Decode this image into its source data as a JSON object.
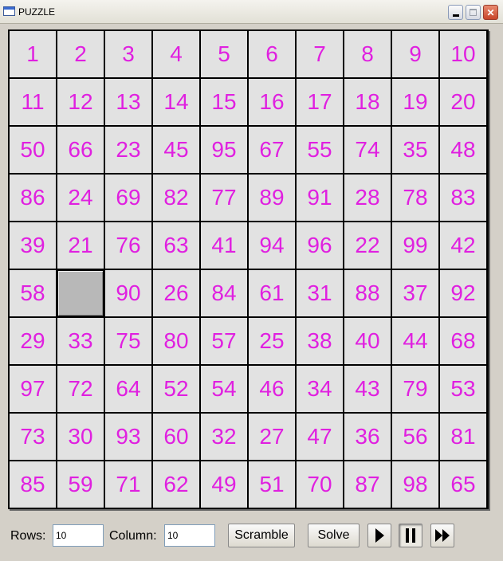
{
  "window": {
    "title": "PUZZLE",
    "minimize_icon": "minimize-icon",
    "maximize_icon": "maximize-icon",
    "close_label": "✕"
  },
  "board": {
    "rows": 10,
    "columns": 10,
    "tile_text_color": "#e020e0",
    "tile_bg_color": "#e2e2e2",
    "blank_bg_color": "#b8b8b8",
    "tiles": [
      [
        "1",
        "2",
        "3",
        "4",
        "5",
        "6",
        "7",
        "8",
        "9",
        "10"
      ],
      [
        "11",
        "12",
        "13",
        "14",
        "15",
        "16",
        "17",
        "18",
        "19",
        "20"
      ],
      [
        "50",
        "66",
        "23",
        "45",
        "95",
        "67",
        "55",
        "74",
        "35",
        "48"
      ],
      [
        "86",
        "24",
        "69",
        "82",
        "77",
        "89",
        "91",
        "28",
        "78",
        "83"
      ],
      [
        "39",
        "21",
        "76",
        "63",
        "41",
        "94",
        "96",
        "22",
        "99",
        "42"
      ],
      [
        "58",
        "",
        "90",
        "26",
        "84",
        "61",
        "31",
        "88",
        "37",
        "92"
      ],
      [
        "29",
        "33",
        "75",
        "80",
        "57",
        "25",
        "38",
        "40",
        "44",
        "68"
      ],
      [
        "97",
        "72",
        "64",
        "52",
        "54",
        "46",
        "34",
        "43",
        "79",
        "53"
      ],
      [
        "73",
        "30",
        "93",
        "60",
        "32",
        "27",
        "47",
        "36",
        "56",
        "81"
      ],
      [
        "85",
        "59",
        "71",
        "62",
        "49",
        "51",
        "70",
        "87",
        "98",
        "65"
      ]
    ]
  },
  "controls": {
    "rows_label": "Rows:",
    "rows_value": "10",
    "column_label": "Column:",
    "column_value": "10",
    "scramble_label": "Scramble",
    "solve_label": "Solve",
    "play_icon": "play-icon",
    "pause_icon": "pause-icon",
    "fast_forward_icon": "fast-forward-icon"
  }
}
